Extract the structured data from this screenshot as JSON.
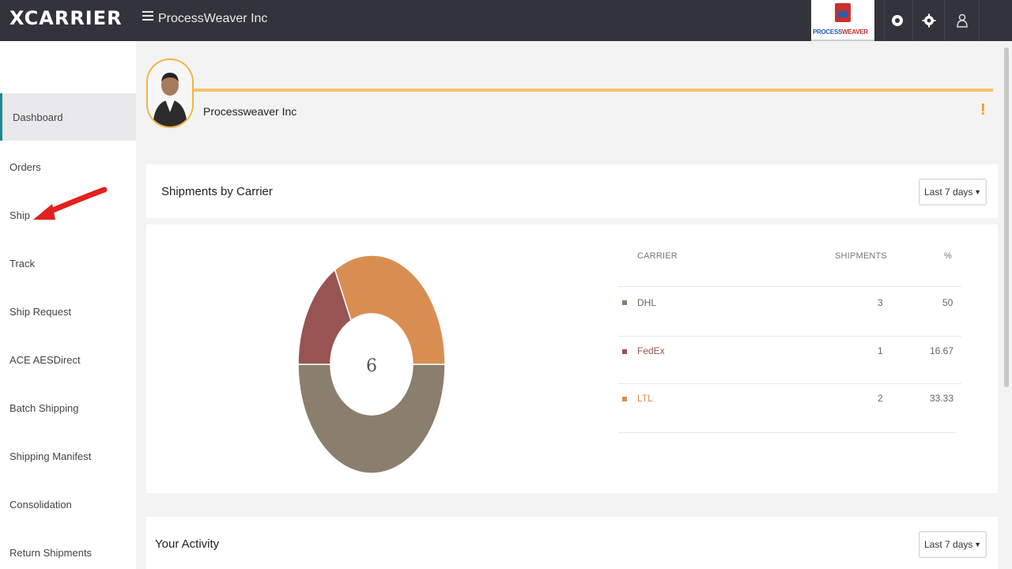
{
  "header": {
    "brand": "XCARRIER",
    "org_name": "ProcessWeaver Inc",
    "logo_text_a": "PROCESS",
    "logo_text_b": "WEAVER",
    "icons": [
      "help-icon",
      "settings-icon",
      "user-icon"
    ]
  },
  "sidebar": {
    "items": [
      {
        "label": "Dashboard",
        "active": true
      },
      {
        "label": "Orders"
      },
      {
        "label": "Ship"
      },
      {
        "label": "Track"
      },
      {
        "label": "Ship Request"
      },
      {
        "label": "ACE AESDirect"
      },
      {
        "label": "Batch Shipping"
      },
      {
        "label": "Shipping Manifest"
      },
      {
        "label": "Consolidation"
      },
      {
        "label": "Return Shipments"
      }
    ]
  },
  "profile": {
    "name": "Processweaver Inc",
    "alert": "!"
  },
  "shipments_card": {
    "title": "Shipments by Carrier",
    "range": "Last 7 days",
    "total": "6",
    "columns": {
      "carrier": "CARRIER",
      "shipments": "SHIPMENTS",
      "percent": "%"
    },
    "rows": [
      {
        "carrier": "DHL",
        "shipments": "3",
        "percent": "50",
        "color": "#8a7e6c"
      },
      {
        "carrier": "FedEx",
        "shipments": "1",
        "percent": "16.67",
        "color": "#975452"
      },
      {
        "carrier": "LTL",
        "shipments": "2",
        "percent": "33.33",
        "color": "#d98e51"
      }
    ]
  },
  "activity_card": {
    "title": "Your Activity",
    "range": "Last 7 days"
  },
  "chart_data": {
    "type": "pie",
    "categories": [
      "DHL",
      "FedEx",
      "LTL"
    ],
    "values": [
      3,
      1,
      2
    ],
    "colors": [
      "#8a7e6c",
      "#975452",
      "#d98e51"
    ]
  }
}
